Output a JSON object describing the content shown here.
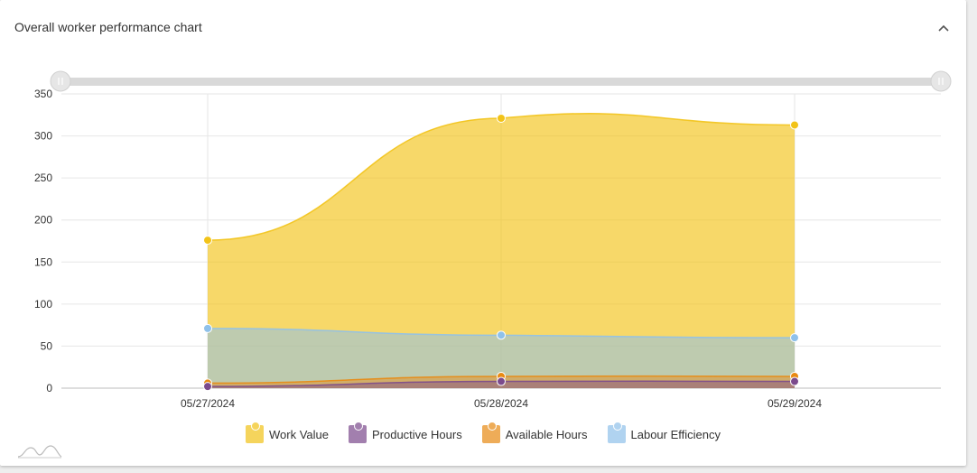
{
  "header": {
    "title": "Overall worker performance chart"
  },
  "icons": {
    "collapse": "chevron-up-icon",
    "logo": "amcharts-logo-icon",
    "grip": "grip-icon"
  },
  "chart_data": {
    "type": "area",
    "categories": [
      "05/27/2024",
      "05/28/2024",
      "05/29/2024"
    ],
    "ylim": [
      0,
      350
    ],
    "yticks": [
      "0",
      "50",
      "100",
      "150",
      "200",
      "250",
      "300",
      "350"
    ],
    "series": [
      {
        "name": "Work Value",
        "values": [
          176,
          321,
          313
        ],
        "color": "#f2c318"
      },
      {
        "name": "Productive Hours",
        "values": [
          2,
          8,
          8
        ],
        "color": "#7b4a8c"
      },
      {
        "name": "Available Hours",
        "values": [
          6,
          14,
          14
        ],
        "color": "#e88a12"
      },
      {
        "name": "Labour Efficiency",
        "values": [
          71,
          63,
          60
        ],
        "color": "#8fc1ea"
      }
    ],
    "legend_position": "bottom",
    "grid": true,
    "scrollbar": true
  }
}
